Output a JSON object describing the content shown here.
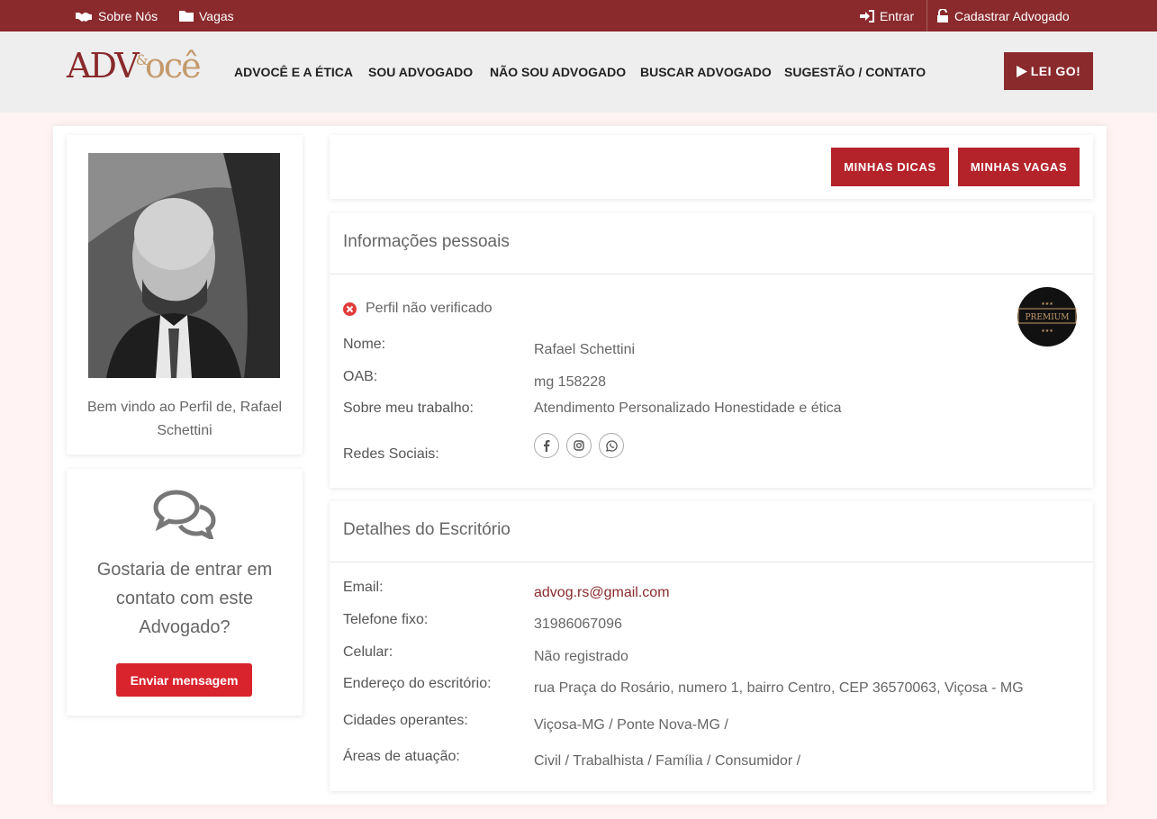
{
  "topbar": {
    "about": "Sobre Nós",
    "jobs": "Vagas",
    "login": "Entrar",
    "register": "Cadastrar Advogado"
  },
  "header": {
    "logo": {
      "adv": "ADV",
      "amp": "&",
      "voce": "ocê"
    },
    "nav": [
      "ADVOCÊ E A ÉTICA",
      "SOU ADVOGADO",
      "NÃO SOU ADVOGADO",
      "BUSCAR ADVOGADO",
      "SUGESTÃO / CONTATO"
    ],
    "cta": "LEI GO!"
  },
  "profile": {
    "welcome": "Bem vindo ao Perfil de, Rafael Schettini"
  },
  "contact_card": {
    "question": "Gostaria de entrar em contato com este Advogado?",
    "button": "Enviar mensagem"
  },
  "actions": {
    "tips": "MINHAS DICAS",
    "jobs": "MINHAS VAGAS"
  },
  "personal": {
    "title": "Informações pessoais",
    "status": "Perfil não verificado",
    "badge": "PREMIUM",
    "name_label": "Nome:",
    "name": "Rafael Schettini",
    "oab_label": "OAB:",
    "oab": "mg 158228",
    "about_label": "Sobre meu trabalho:",
    "about": "Atendimento Personalizado Honestidade e ética",
    "social_label": "Redes Sociais:",
    "social_icons": [
      "facebook-icon",
      "instagram-icon",
      "whatsapp-icon"
    ]
  },
  "office": {
    "title": "Detalhes do Escritório",
    "email_label": "Email:",
    "email": "advog.rs@gmail.com",
    "phone_label": "Telefone fixo:",
    "phone": "31986067096",
    "mobile_label": "Celular:",
    "mobile": "Não registrado",
    "address_label": "Endereço do escritório:",
    "address": "rua Praça do Rosário, numero 1, bairro Centro, CEP 36570063, Viçosa - MG",
    "cities_label": "Cidades operantes:",
    "cities": "Viçosa-MG / Ponte Nova-MG /",
    "areas_label": "Áreas de atuação:",
    "areas": "Civil / Trabalhista / Família / Consumidor /"
  },
  "colors": {
    "brand": "#8a2a2c",
    "gold": "#c49a6c",
    "button_red": "#b5232a",
    "send_red": "#d9232d"
  }
}
